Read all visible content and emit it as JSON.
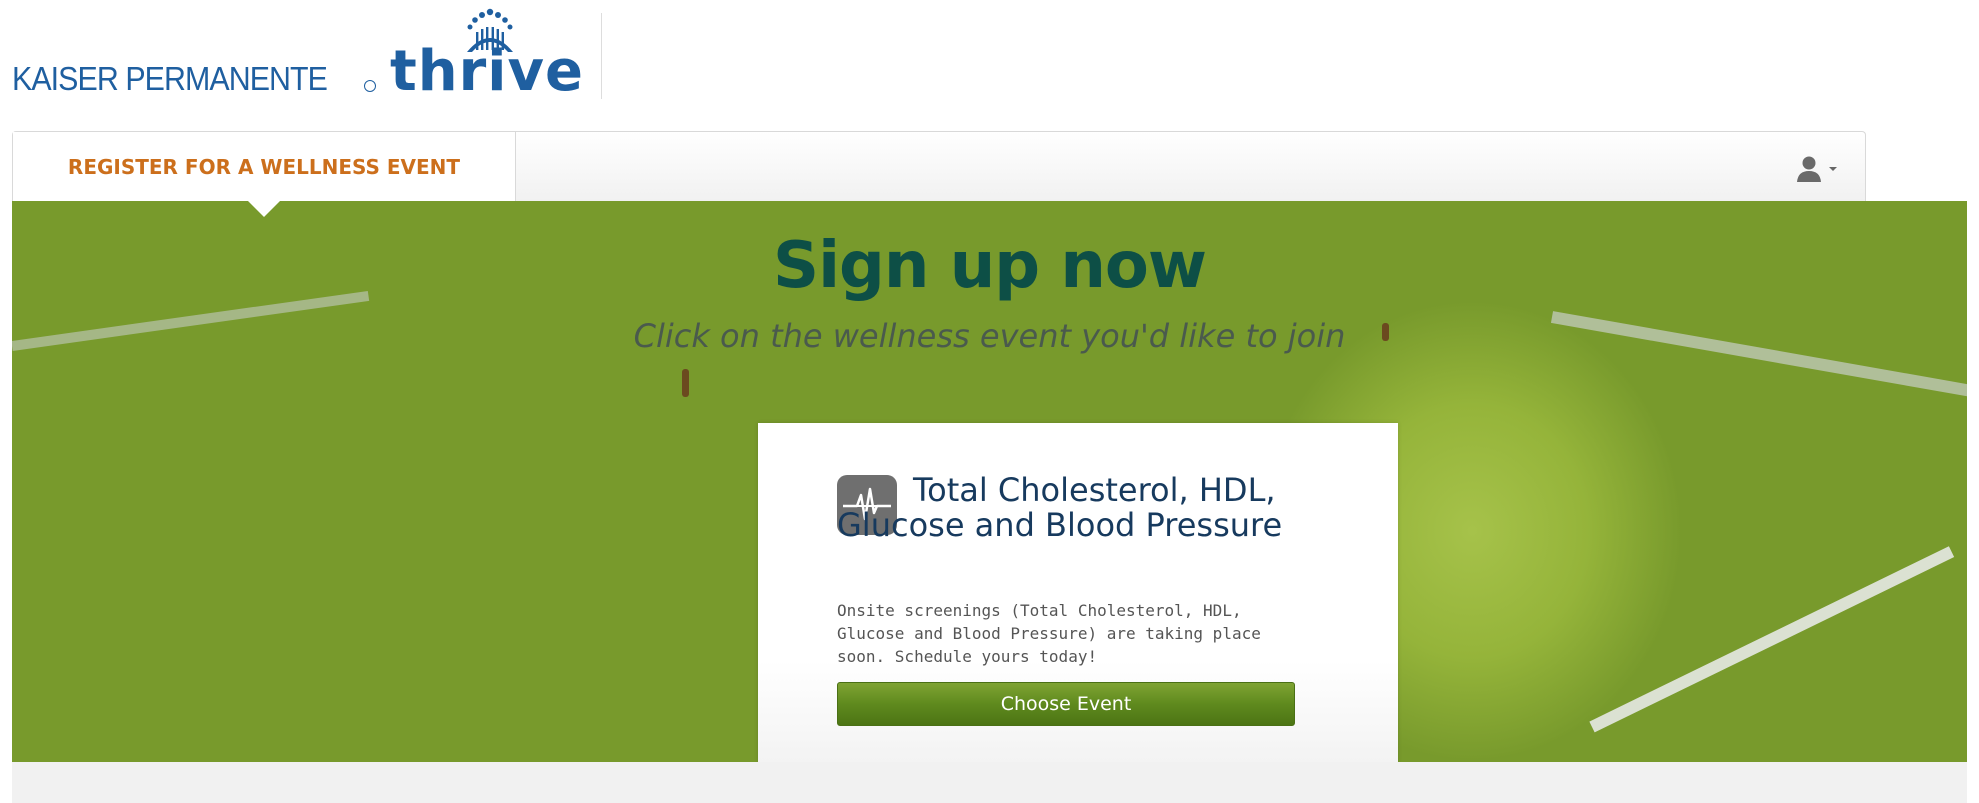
{
  "brand": {
    "company": "KAISER PERMANENTE",
    "product": "thrive"
  },
  "nav": {
    "tab_label": "REGISTER FOR A WELLNESS EVENT",
    "user_icon": "user-icon",
    "caret_icon": "chevron-down-icon"
  },
  "hero": {
    "title": "Sign up now",
    "subtitle": "Click on the wellness event you'd like to join"
  },
  "event": {
    "icon": "heart-monitor-icon",
    "title": "Total Cholesterol, HDL, Glucose and Blood Pressure",
    "description": "Onsite screenings (Total Cholesterol, HDL, Glucose and Blood Pressure) are taking place soon. Schedule yours today!",
    "button_label": "Choose Event"
  },
  "colors": {
    "brand_blue": "#1f5fa0",
    "tab_orange": "#cc6f1c",
    "hero_title_green": "#0d4f46",
    "button_green": "#5f8a1e",
    "event_title_navy": "#173a5e"
  }
}
